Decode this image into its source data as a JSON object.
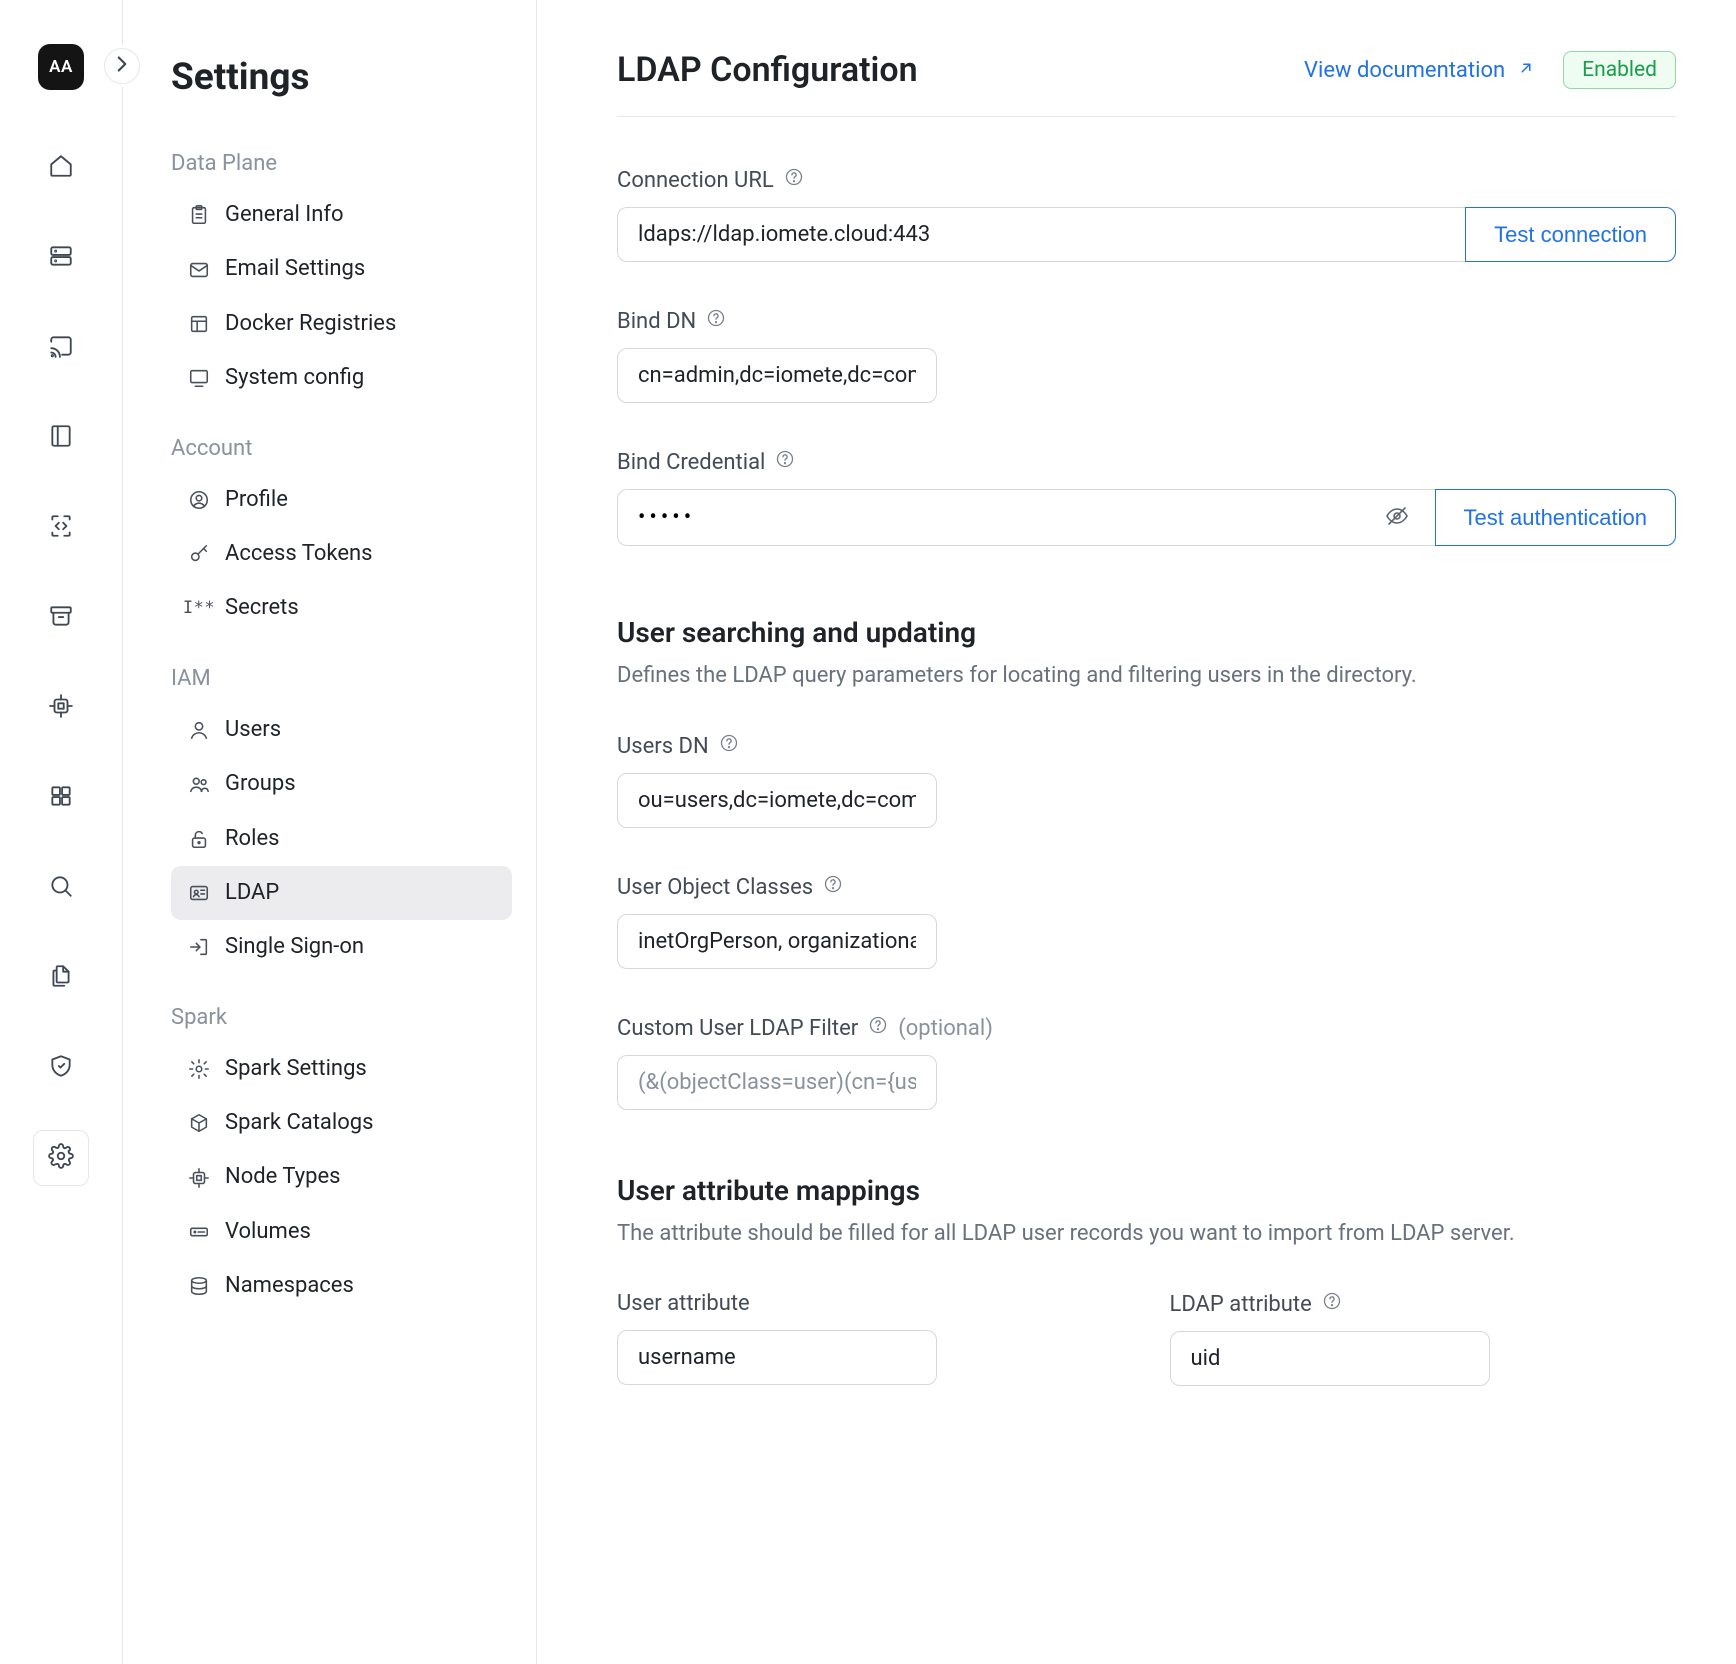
{
  "rail": {
    "logo": "AA"
  },
  "sidebar": {
    "title": "Settings",
    "groups": [
      {
        "label": "Data Plane",
        "items": [
          {
            "label": "General Info"
          },
          {
            "label": "Email Settings"
          },
          {
            "label": "Docker Registries"
          },
          {
            "label": "System config"
          }
        ]
      },
      {
        "label": "Account",
        "items": [
          {
            "label": "Profile"
          },
          {
            "label": "Access Tokens"
          },
          {
            "label": "Secrets"
          }
        ]
      },
      {
        "label": "IAM",
        "items": [
          {
            "label": "Users"
          },
          {
            "label": "Groups"
          },
          {
            "label": "Roles"
          },
          {
            "label": "LDAP"
          },
          {
            "label": "Single Sign-on"
          }
        ]
      },
      {
        "label": "Spark",
        "items": [
          {
            "label": "Spark Settings"
          },
          {
            "label": "Spark Catalogs"
          },
          {
            "label": "Node Types"
          },
          {
            "label": "Volumes"
          },
          {
            "label": "Namespaces"
          }
        ]
      }
    ]
  },
  "page": {
    "title": "LDAP Configuration",
    "doc_link": "View documentation",
    "status": "Enabled",
    "fields": {
      "connection_url": {
        "label": "Connection URL",
        "value": "ldaps://ldap.iomete.cloud:443",
        "button": "Test connection"
      },
      "bind_dn": {
        "label": "Bind DN",
        "value": "cn=admin,dc=iomete,dc=com"
      },
      "bind_credential": {
        "label": "Bind Credential",
        "value": "•••••",
        "button": "Test authentication"
      },
      "users_dn": {
        "label": "Users DN",
        "value": "ou=users,dc=iomete,dc=com"
      },
      "user_object_classes": {
        "label": "User Object Classes",
        "value": "inetOrgPerson, organizationalPerson"
      },
      "custom_filter": {
        "label": "Custom User LDAP Filter",
        "optional": "(optional)",
        "placeholder": "(&(objectClass=user)(cn={username}))"
      },
      "user_attr": {
        "label": "User attribute",
        "value": "username"
      },
      "ldap_attr": {
        "label": "LDAP attribute",
        "value": "uid"
      }
    },
    "sections": {
      "search": {
        "title": "User searching and updating",
        "desc": "Defines the LDAP query parameters for locating and filtering users in the directory."
      },
      "mapping": {
        "title": "User attribute mappings",
        "desc": "The attribute should be filled for all LDAP user records you want to import from LDAP server."
      }
    }
  }
}
